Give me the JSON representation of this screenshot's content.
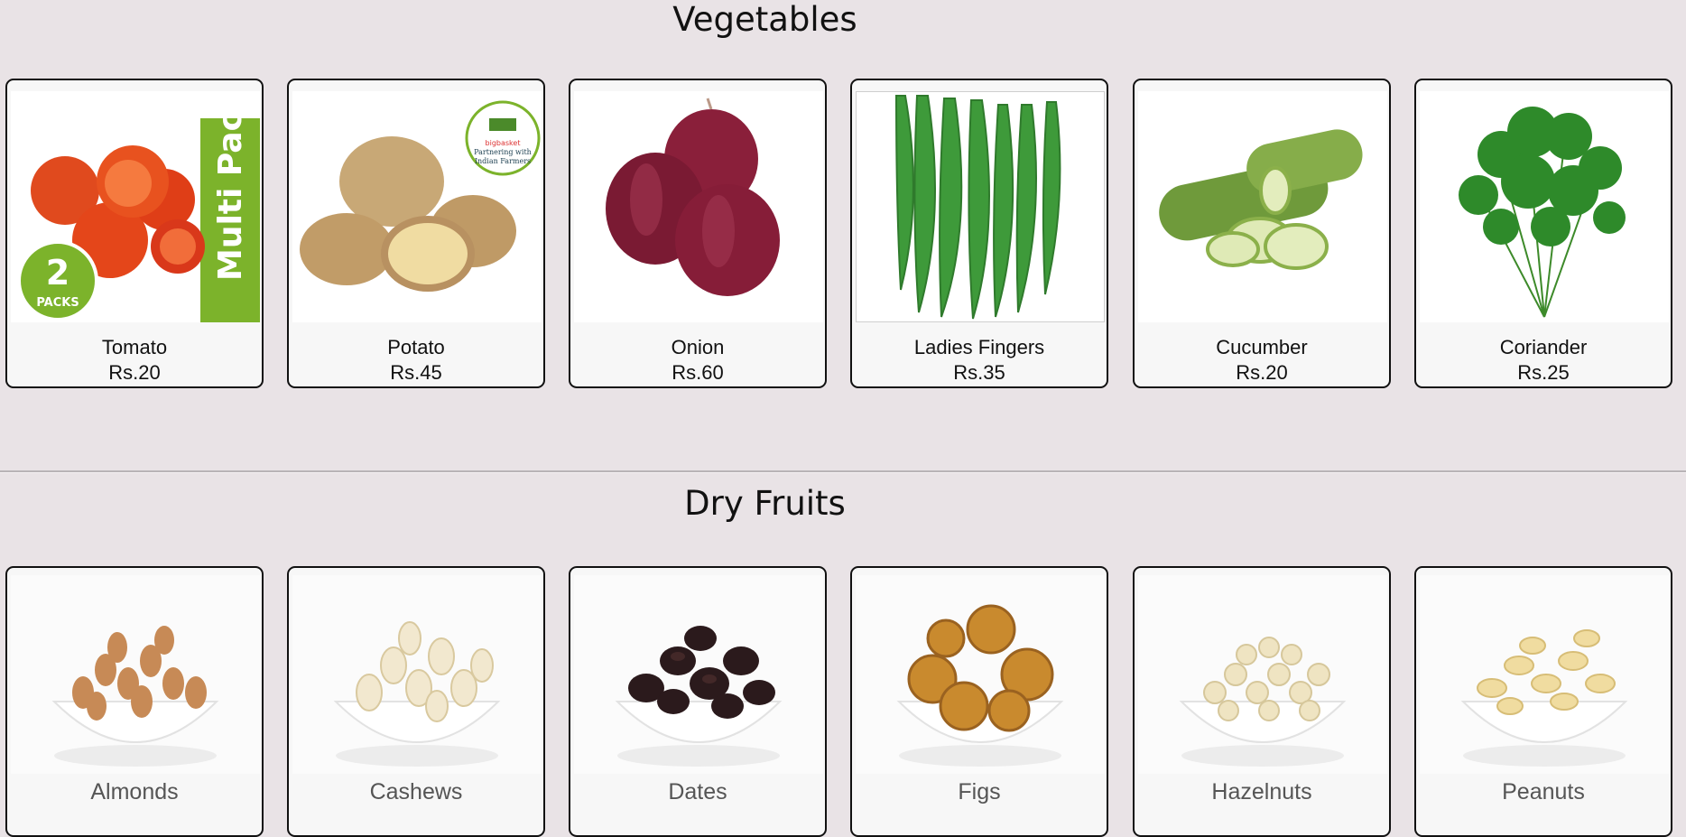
{
  "sections": [
    {
      "title": "Vegetables",
      "items": [
        {
          "name": "Tomato",
          "price": "Rs.20",
          "icon": "tomato-image",
          "badge_text": "Multi Pack",
          "pack_text": "2",
          "pack_sub": "PACKS"
        },
        {
          "name": "Potato",
          "price": "Rs.45",
          "icon": "potato-image",
          "brand_line1": "bigbasket",
          "brand_line2": "Partnering with",
          "brand_line3": "Indian Farmers"
        },
        {
          "name": "Onion",
          "price": "Rs.60",
          "icon": "onion-image"
        },
        {
          "name": "Ladies Fingers",
          "price": "Rs.35",
          "icon": "okra-image"
        },
        {
          "name": "Cucumber",
          "price": "Rs.20",
          "icon": "cucumber-image"
        },
        {
          "name": "Coriander",
          "price": "Rs.25",
          "icon": "coriander-image"
        }
      ]
    },
    {
      "title": "Dry Fruits",
      "items": [
        {
          "name": "Almonds",
          "icon": "almonds-image"
        },
        {
          "name": "Cashews",
          "icon": "cashews-image"
        },
        {
          "name": "Dates",
          "icon": "dates-image"
        },
        {
          "name": "Figs",
          "icon": "figs-image"
        },
        {
          "name": "Hazelnuts",
          "icon": "hazelnuts-image"
        },
        {
          "name": "Peanuts",
          "icon": "peanuts-image"
        }
      ]
    }
  ],
  "colors": {
    "page_background": "#e9e3e6",
    "card_border": "#111111",
    "multipack_green": "#7cb32b"
  }
}
